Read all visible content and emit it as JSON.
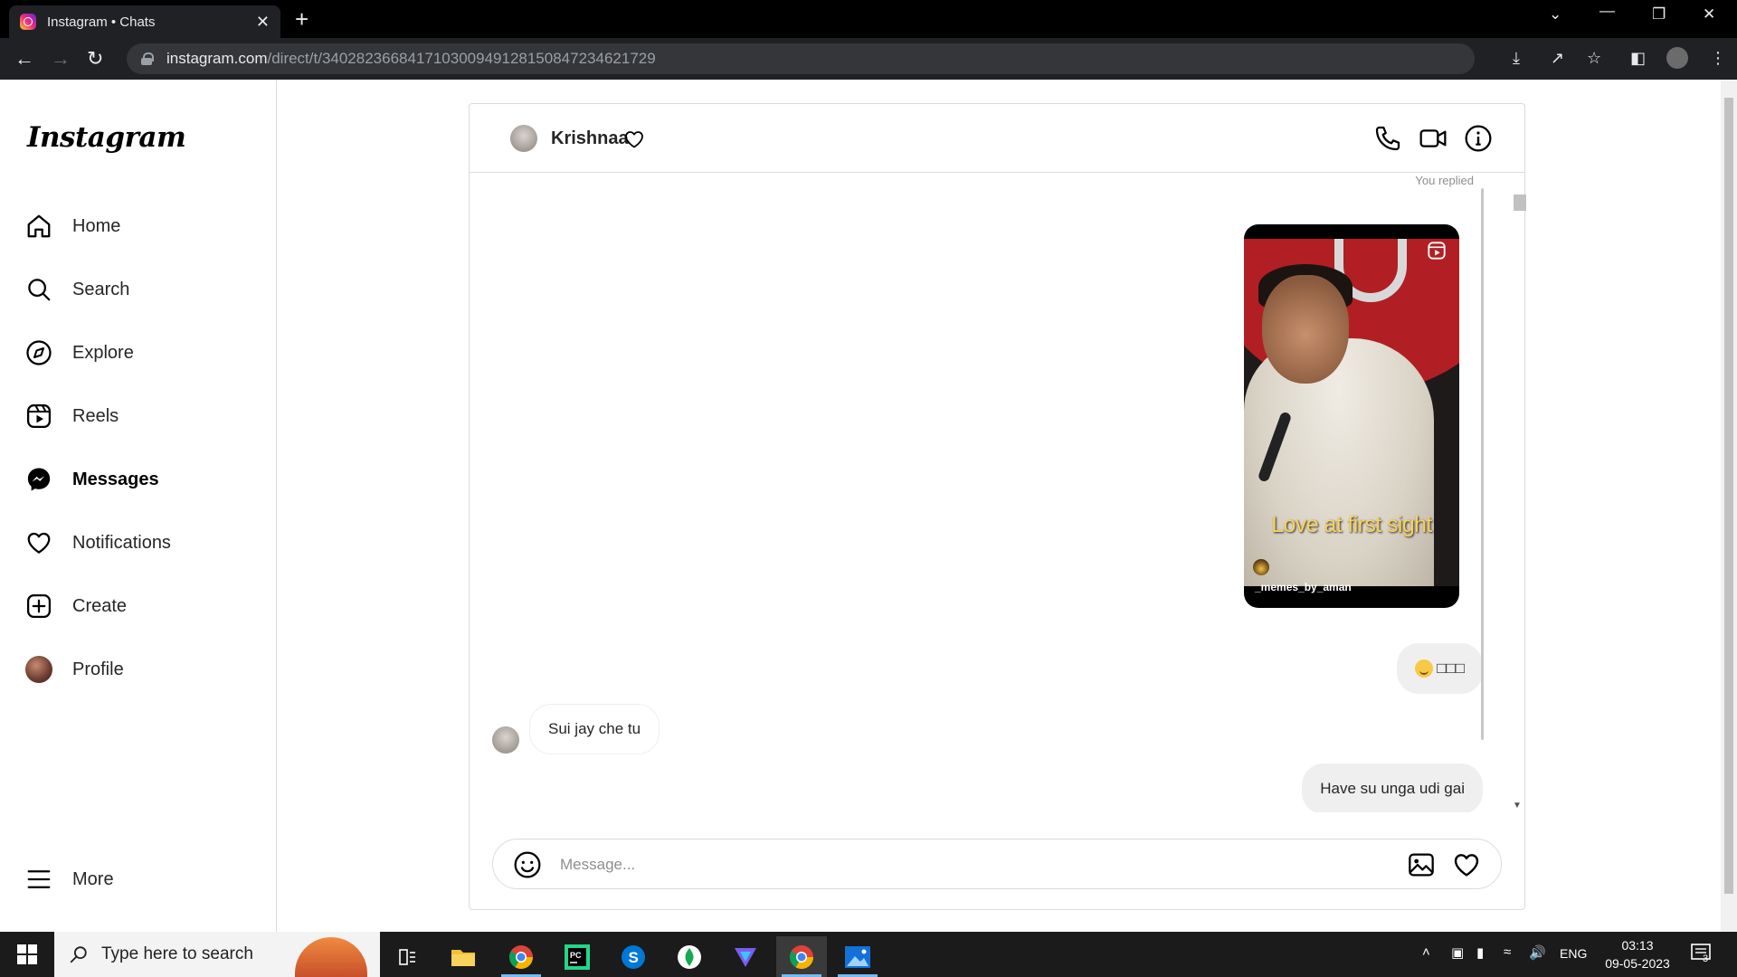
{
  "browser": {
    "tab_title": "Instagram • Chats",
    "tab_close": "✕",
    "new_tab": "+",
    "url_domain": "instagram.com",
    "url_path": "/direct/t/340282366841710300949128150847234621729"
  },
  "sidebar": {
    "logo": "Instagram",
    "items": [
      {
        "label": "Home",
        "icon": "home-icon"
      },
      {
        "label": "Search",
        "icon": "search-icon"
      },
      {
        "label": "Explore",
        "icon": "compass-icon"
      },
      {
        "label": "Reels",
        "icon": "reels-icon"
      },
      {
        "label": "Messages",
        "icon": "messenger-icon",
        "active": true
      },
      {
        "label": "Notifications",
        "icon": "heart-icon"
      },
      {
        "label": "Create",
        "icon": "plus-square-icon"
      },
      {
        "label": "Profile",
        "icon": "avatar"
      }
    ],
    "more_label": "More"
  },
  "chat": {
    "contact_name": "Krishnaa",
    "you_replied": "You replied",
    "reel": {
      "caption": "Love at first sight",
      "owner": "_memes_by_aman"
    },
    "messages": [
      {
        "direction": "outgoing",
        "text": "😏□□□"
      },
      {
        "direction": "incoming",
        "text": "Sui jay che tu"
      },
      {
        "direction": "outgoing",
        "text": "Have su unga udi gai"
      }
    ],
    "emoji_bubble_suffix": "□□□",
    "composer_placeholder": "Message..."
  },
  "taskbar": {
    "search_placeholder": "Type here to search",
    "language": "ENG",
    "time": "03:13",
    "date": "09-05-2023",
    "notification_count": "3"
  },
  "colors": {
    "browser_bg": "#202124",
    "sidebar_border": "#dbdbdb",
    "bubble_bg": "#efefef",
    "taskbar_bg": "#1b1b1b"
  }
}
